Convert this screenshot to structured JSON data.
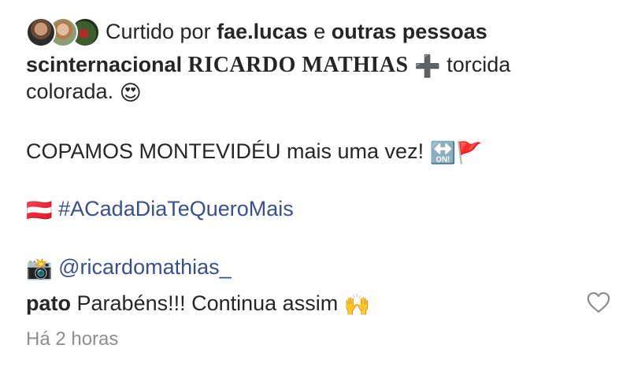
{
  "liked": {
    "prefix": "Curtido por",
    "user": "fae.lucas",
    "connector": "e",
    "others": "outras pessoas"
  },
  "caption": {
    "username": "scinternacional",
    "name_styled": "RICARDO MATHIAS",
    "plus_emoji": "➕",
    "text_after_plus": "torcida",
    "line2_text": "colorada.",
    "heart_eyes_emoji": "😍",
    "line3_text": "COPAMOS MONTEVIDÉU mais uma vez!",
    "on_arrow_emoji": "🔛",
    "flag_emoji": "🚩",
    "austria_flag_emoji": "🇦🇹",
    "hashtag": "#ACadaDiaTeQueroMais",
    "camera_emoji": "📸",
    "mention": "@ricardomathias_"
  },
  "comment": {
    "username": "pato",
    "text": "Parabéns!!! Continua assim",
    "emoji": "🙌"
  },
  "timestamp": "Há 2 horas",
  "colors": {
    "text": "#262626",
    "link": "#38508f",
    "muted": "#8e8e8e"
  }
}
